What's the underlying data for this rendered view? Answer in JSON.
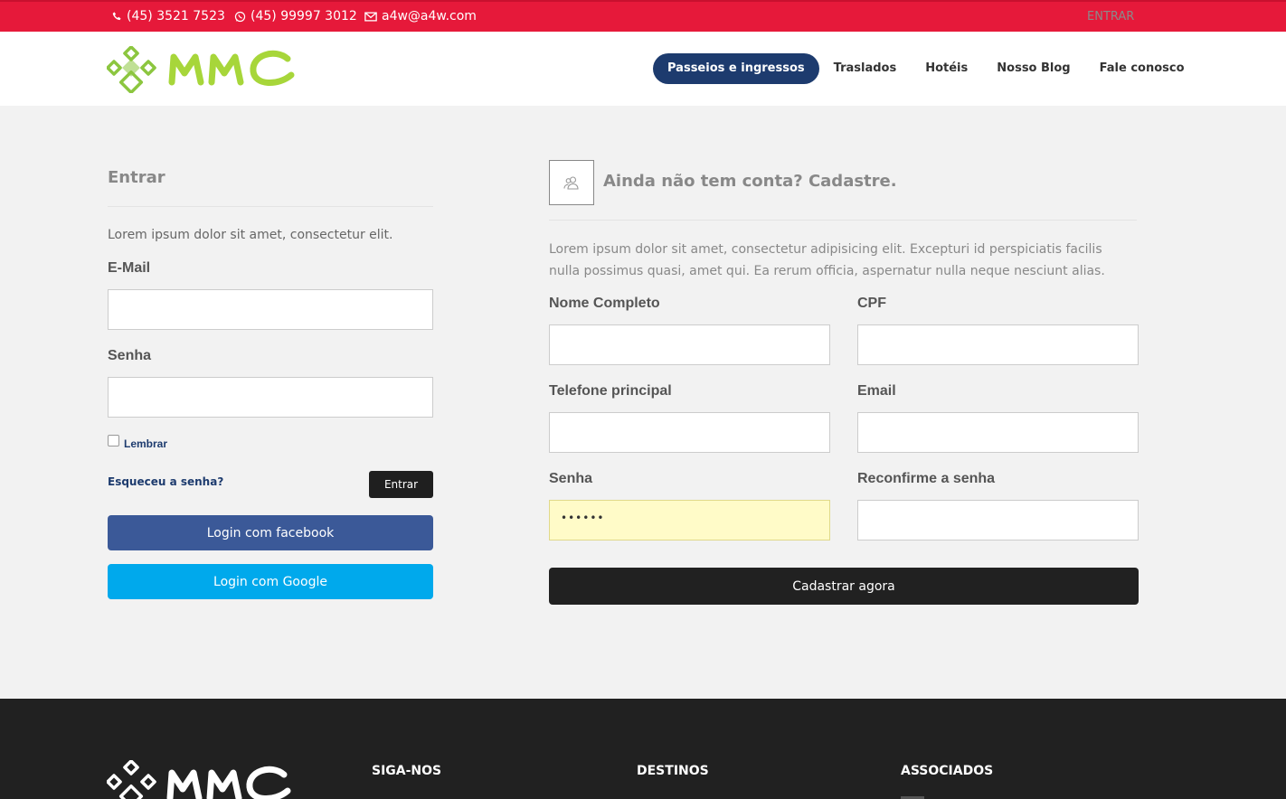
{
  "topbar": {
    "phone": "(45) 3521 7523",
    "whatsapp": "(45) 99997 3012",
    "email": "a4w@a4w.com",
    "login_link": "ENTRAR",
    "colors": {
      "background": "#e6193a"
    }
  },
  "header": {
    "logo_text": "MMC",
    "nav": [
      {
        "label": "Passeios e ingressos",
        "active": true
      },
      {
        "label": "Traslados"
      },
      {
        "label": "Hotéis"
      },
      {
        "label": "Nosso Blog"
      },
      {
        "label": "Fale conosco"
      }
    ],
    "colors": {
      "active_nav": "#1d3b6e",
      "logo_green": "#8cc63f"
    }
  },
  "login": {
    "title": "Entrar",
    "description": "Lorem ipsum dolor sit amet, consectetur elit.",
    "email_label": "E-Mail",
    "email_value": "",
    "password_label": "Senha",
    "password_value": "",
    "remember_label": "Lembrar",
    "remember_checked": false,
    "forgot_label": "Esqueceu a senha?",
    "submit_label": "Entrar",
    "facebook_label": "Login com facebook",
    "google_label": "Login com Google",
    "colors": {
      "facebook": "#3b5998",
      "google": "#00a9ec"
    }
  },
  "register": {
    "icon": "users-icon",
    "title": "Ainda não tem conta? Cadastre.",
    "description": "Lorem ipsum dolor sit amet, consectetur adipisicing elit. Excepturi id perspiciatis facilis nulla possimus quasi, amet qui. Ea rerum officia, aspernatur nulla neque nesciunt alias.",
    "fields": {
      "nome_label": "Nome Completo",
      "cpf_label": "CPF",
      "telefone_label": "Telefone principal",
      "email_label": "Email",
      "senha_label": "Senha",
      "senha_value": "••••••",
      "reconfirme_label": "Reconfirme a senha"
    },
    "submit_label": "Cadastrar agora"
  },
  "footer": {
    "logo_text": "MMC",
    "columns": [
      "SIGA-NOS",
      "DESTINOS",
      "ASSOCIADOS"
    ]
  }
}
